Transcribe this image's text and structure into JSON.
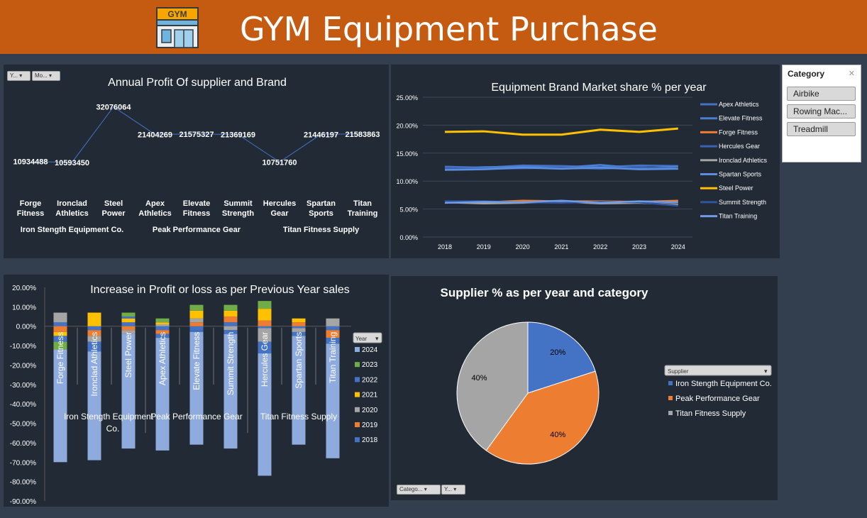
{
  "header": {
    "title": "GYM Equipment Purchase",
    "icon": "gym-storefront-icon",
    "icon_sign": "GYM"
  },
  "colors": {
    "banner": "#c55a11",
    "panel": "#222b35",
    "background": "#333f4f"
  },
  "slicer": {
    "title": "Category",
    "items": [
      "Airbike",
      "Rowing Mac...",
      "Treadmill"
    ]
  },
  "field_buttons": {
    "profit_year": "Y...",
    "profit_month": "Mo...",
    "growth_year": "Year",
    "pie_supplier": "Supplier",
    "pie_category": "Catego...",
    "pie_year": "Y..."
  },
  "chart_data": [
    {
      "type": "line",
      "title": "Annual Profit Of supplier and Brand",
      "groups": [
        {
          "name": "Iron Stength Equipment Co.",
          "brands": [
            "Forge Fitness",
            "Ironclad Athletics",
            "Steel Power"
          ]
        },
        {
          "name": "Peak Performance Gear",
          "brands": [
            "Apex Athletics",
            "Elevate Fitness",
            "Summit Strength"
          ]
        },
        {
          "name": "Titan Fitness Supply",
          "brands": [
            "Hercules Gear",
            "Spartan Sports",
            "Titan Training"
          ]
        }
      ],
      "categories": [
        "Forge Fitness",
        "Ironclad Athletics",
        "Steel Power",
        "Apex Athletics",
        "Elevate Fitness",
        "Summit Strength",
        "Hercules Gear",
        "Spartan Sports",
        "Titan Training"
      ],
      "values": [
        10934488,
        10593450,
        32076064,
        21404269,
        21575327,
        21369169,
        10751760,
        21446197,
        21583863
      ]
    },
    {
      "type": "line",
      "title": "Equipment Brand Market share % per year",
      "x": [
        2018,
        2019,
        2020,
        2021,
        2022,
        2023,
        2024
      ],
      "ylim": [
        0,
        25
      ],
      "yticks": [
        "0.00%",
        "5.00%",
        "10.00%",
        "15.00%",
        "20.00%",
        "25.00%"
      ],
      "legend": "right",
      "series": [
        {
          "name": "Apex Athletics",
          "color": "#4472c4",
          "values": [
            12.6,
            12.4,
            12.8,
            12.7,
            12.5,
            12.8,
            12.7
          ]
        },
        {
          "name": "Elevate Fitness",
          "color": "#4a7fd4",
          "values": [
            12.2,
            12.5,
            12.6,
            12.4,
            12.9,
            12.3,
            12.6
          ]
        },
        {
          "name": "Forge Fitness",
          "color": "#ed7d31",
          "values": [
            6.3,
            6.2,
            6.5,
            6.4,
            6.4,
            6.3,
            6.5
          ]
        },
        {
          "name": "Hercules Gear",
          "color": "#3a62b0",
          "values": [
            12.3,
            12.2,
            12.3,
            12.4,
            12.2,
            12.5,
            12.2
          ]
        },
        {
          "name": "Ironclad Athletics",
          "color": "#a5a5a5",
          "values": [
            6.2,
            6.0,
            6.1,
            6.3,
            6.0,
            6.1,
            5.8
          ]
        },
        {
          "name": "Spartan Sports",
          "color": "#5b8de0",
          "values": [
            12.0,
            12.1,
            12.4,
            12.2,
            12.4,
            12.1,
            12.2
          ]
        },
        {
          "name": "Steel Power",
          "color": "#ffc000",
          "values": [
            18.8,
            18.9,
            18.3,
            18.3,
            19.2,
            18.8,
            19.4
          ]
        },
        {
          "name": "Summit Strength",
          "color": "#2f55a0",
          "values": [
            6.4,
            6.4,
            6.2,
            6.1,
            6.3,
            6.2,
            5.6
          ]
        },
        {
          "name": "Titan Training",
          "color": "#6f9be8",
          "values": [
            6.1,
            6.3,
            6.2,
            6.5,
            6.1,
            6.4,
            6.2
          ]
        }
      ]
    },
    {
      "type": "bar",
      "title": "Increase in Profit or loss as per Previous Year sales",
      "categories": [
        "Forge Fitness",
        "Ironclad Athletics",
        "Steel Power",
        "Apex Athletics",
        "Elevate Fitness",
        "Summit Strength",
        "Hercules Gear",
        "Spartan Sports",
        "Titan Training"
      ],
      "groups": [
        "Iron Stength Equipment Co.",
        "Peak Performance Gear",
        "Titan Fitness Supply"
      ],
      "ylim": [
        -90,
        20
      ],
      "yticks": [
        "20.00%",
        "10.00%",
        "0.00%",
        "-10.00%",
        "-20.00%",
        "-30.00%",
        "-40.00%",
        "-50.00%",
        "-60.00%",
        "-70.00%",
        "-80.00%",
        "-90.00%"
      ],
      "legend": "right",
      "series": [
        {
          "name": "2024",
          "color": "#8faadc",
          "values": [
            -58,
            -56,
            -59,
            -58,
            -58,
            -59,
            -63,
            -56,
            -59
          ]
        },
        {
          "name": "2023",
          "color": "#70ad47",
          "values": [
            -4,
            0,
            2,
            2,
            3,
            3,
            4,
            0,
            0
          ]
        },
        {
          "name": "2022",
          "color": "#4472c4",
          "values": [
            -3,
            -5,
            1,
            -2,
            -1,
            -2,
            -6,
            -2,
            -3
          ]
        },
        {
          "name": "2021",
          "color": "#ffc000",
          "values": [
            -2,
            7,
            2,
            1,
            4,
            3,
            6,
            2,
            0
          ]
        },
        {
          "name": "2020",
          "color": "#a5a5a5",
          "values": [
            5,
            -3,
            -2,
            1,
            2,
            -2,
            -7,
            -2,
            4
          ]
        },
        {
          "name": "2019",
          "color": "#ed7d31",
          "values": [
            -3,
            -3,
            -2,
            -2,
            2,
            3,
            3,
            2,
            -4
          ]
        },
        {
          "name": "2018",
          "color": "#4472c4",
          "values": [
            2,
            -2,
            2,
            -2,
            -2,
            2,
            -1,
            -1,
            -2
          ]
        }
      ]
    },
    {
      "type": "pie",
      "title": "Supplier  % as per year and category",
      "categories": [
        "Iron Stength Equipment Co.",
        "Peak Performance Gear",
        "Titan Fitness Supply"
      ],
      "values": [
        20,
        40,
        40
      ],
      "labels": [
        "20%",
        "40%",
        "40%"
      ],
      "colors": [
        "#4472c4",
        "#ed7d31",
        "#a5a5a5"
      ],
      "legend": "right"
    }
  ]
}
